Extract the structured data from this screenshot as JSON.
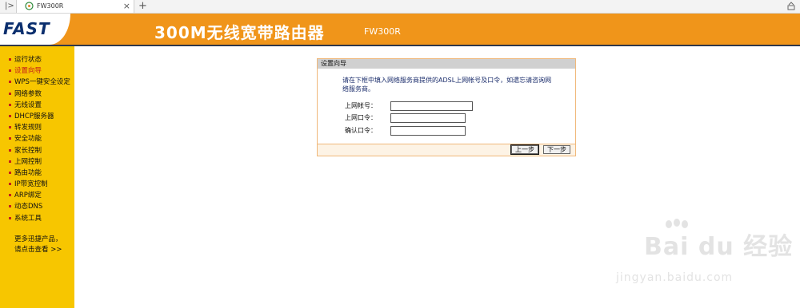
{
  "browser": {
    "tab_title": "FW300R",
    "nav_glyph": "|>",
    "close_glyph": "×",
    "new_tab_glyph": "+"
  },
  "header": {
    "logo": "FAST",
    "title": "300M无线宽带路由器",
    "model": "FW300R",
    "color": "#f0951a"
  },
  "sidebar": {
    "items": [
      {
        "label": "运行状态",
        "active": false
      },
      {
        "label": "设置向导",
        "active": true
      },
      {
        "label": "WPS一键安全设定",
        "active": false
      },
      {
        "label": "网络参数",
        "active": false
      },
      {
        "label": "无线设置",
        "active": false
      },
      {
        "label": "DHCP服务器",
        "active": false
      },
      {
        "label": "转发规则",
        "active": false
      },
      {
        "label": "安全功能",
        "active": false
      },
      {
        "label": "家长控制",
        "active": false
      },
      {
        "label": "上网控制",
        "active": false
      },
      {
        "label": "路由功能",
        "active": false
      },
      {
        "label": "IP带宽控制",
        "active": false
      },
      {
        "label": "ARP绑定",
        "active": false
      },
      {
        "label": "动态DNS",
        "active": false
      },
      {
        "label": "系统工具",
        "active": false
      }
    ],
    "promo_line1": "更多迅捷产品，",
    "promo_line2": "请点击查看 >>",
    "bg_color": "#f7c600"
  },
  "wizard": {
    "title": "设置向导",
    "description": "请在下框中填入网络服务商提供的ADSL上网帐号及口令，如遗忘请咨询网络服务商。",
    "fields": [
      {
        "label": "上网帐号：",
        "value": ""
      },
      {
        "label": "上网口令：",
        "value": ""
      },
      {
        "label": "确认口令：",
        "value": ""
      }
    ],
    "prev_label": "上一步",
    "next_label": "下一步"
  },
  "watermark": {
    "text": "Bai du 经验",
    "url": "jingyan.baidu.com"
  }
}
